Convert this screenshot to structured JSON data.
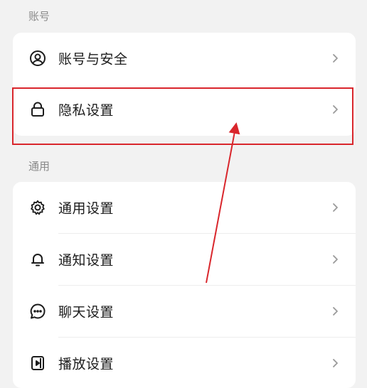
{
  "sections": {
    "account": {
      "label": "账号",
      "items": [
        {
          "label": "账号与安全",
          "icon": "user-circle-icon"
        },
        {
          "label": "隐私设置",
          "icon": "lock-icon"
        }
      ]
    },
    "general": {
      "label": "通用",
      "items": [
        {
          "label": "通用设置",
          "icon": "gear-icon"
        },
        {
          "label": "通知设置",
          "icon": "bell-icon"
        },
        {
          "label": "聊天设置",
          "icon": "chat-bubble-icon"
        },
        {
          "label": "播放设置",
          "icon": "play-device-icon"
        }
      ]
    }
  },
  "annotation": {
    "color": "#d9262c",
    "highlighted_item": "隐私设置"
  }
}
